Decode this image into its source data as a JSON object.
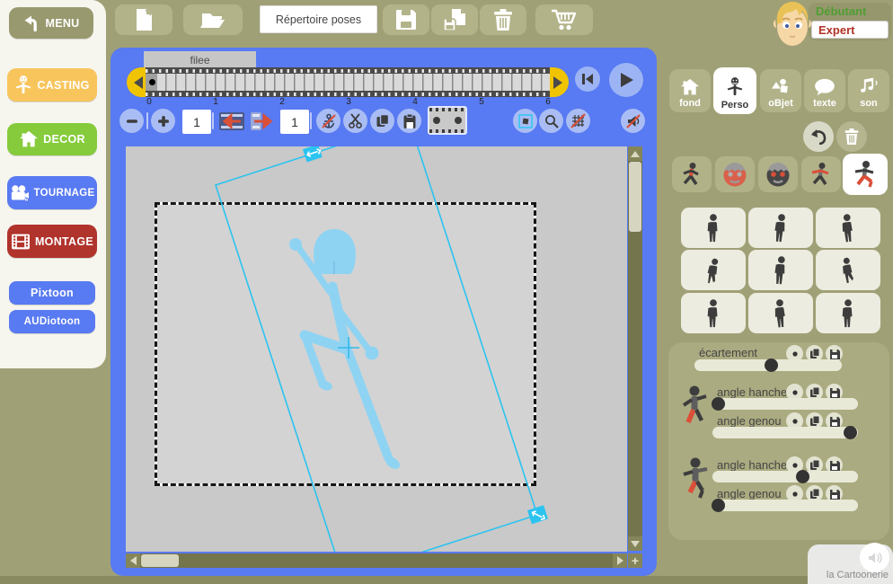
{
  "user": {
    "level_debutant": "Débutant",
    "level_expert": "Expert"
  },
  "topbar": {
    "repertoire": "Répertoire poses"
  },
  "sidebar": {
    "menu": "MENU",
    "casting": "CASTING",
    "decor": "DECOR",
    "tournage": "TOURNAGE",
    "montage": "MONTAGE",
    "pixtoon": "Pixtoon",
    "audiotoon": "AUDiotoon"
  },
  "timeline": {
    "pose_name": "filee",
    "ticks": [
      "0",
      "1",
      "2",
      "3",
      "4",
      "5",
      "6"
    ]
  },
  "frame_toolbar": {
    "count_value": "1",
    "frame_value": "1"
  },
  "panel": {
    "tabs": {
      "fond": "fond",
      "perso": "Perso",
      "objet": "oBjet",
      "texte": "texte",
      "son": "son"
    },
    "selected_tab": "Perso"
  },
  "controls": {
    "ecartement": {
      "label": "écartement",
      "percent": 52
    },
    "leg1": {
      "hanche_label": "angle hanche",
      "hanche_percent": 4,
      "genou_label": "angle genou",
      "genou_percent": 95
    },
    "leg2": {
      "hanche_label": "angle hanche",
      "hanche_percent": 62,
      "genou_label": "angle genou",
      "genou_percent": 4
    }
  },
  "footer": {
    "brand": "la Cartoonerie"
  },
  "colors": {
    "panel_blue": "#587af2",
    "olive_bg": "#a0a077",
    "accent_yellow": "#f0c400",
    "figure_blue": "#8fd3f3",
    "selection_cyan": "#2bc3f0",
    "accent_red": "#d94f38",
    "casting_orange": "#f8c55d",
    "decor_green": "#85cb3b",
    "montage_red": "#b0332c",
    "debutant_green": "#4e9e33",
    "expert_red": "#b23226"
  }
}
